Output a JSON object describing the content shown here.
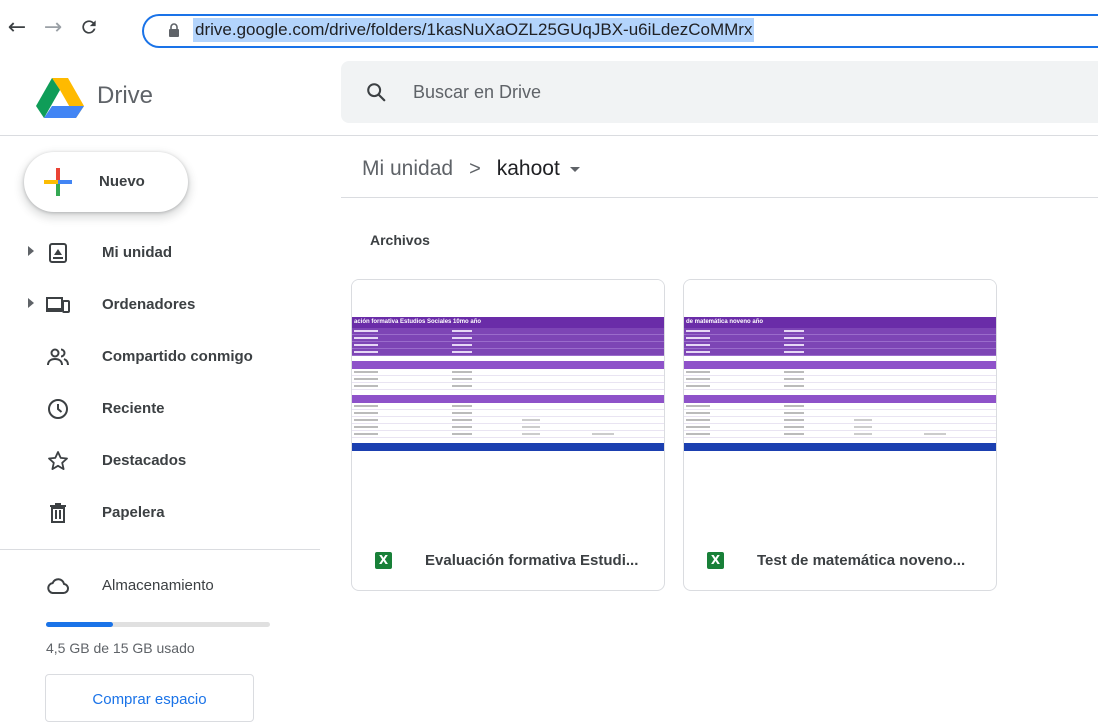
{
  "browser": {
    "url": "drive.google.com/drive/folders/1kasNuXaOZL25GUqJBX-u6iLdezCoMMrx"
  },
  "header": {
    "app_name": "Drive",
    "search_placeholder": "Buscar en Drive"
  },
  "sidebar": {
    "new_label": "Nuevo",
    "items": [
      {
        "label": "Mi unidad",
        "icon": "drive-icon"
      },
      {
        "label": "Ordenadores",
        "icon": "computers-icon"
      },
      {
        "label": "Compartido conmigo",
        "icon": "shared-icon"
      },
      {
        "label": "Reciente",
        "icon": "clock-icon"
      },
      {
        "label": "Destacados",
        "icon": "star-icon"
      },
      {
        "label": "Papelera",
        "icon": "trash-icon"
      }
    ],
    "storage": {
      "label": "Almacenamiento",
      "used_text": "4,5 GB de 15 GB usado",
      "used_fraction": 0.3,
      "buy_label": "Comprar espacio"
    }
  },
  "main": {
    "breadcrumb": {
      "root": "Mi unidad",
      "separator": ">",
      "current": "kahoot"
    },
    "section_title": "Archivos",
    "files": [
      {
        "name": "Evaluación formativa Estudi...",
        "thumb_title": "ación formativa Estudios Sociales 10mo año",
        "type_badge": "X"
      },
      {
        "name": "Test de matemática noveno...",
        "thumb_title": "de matemática noveno año",
        "type_badge": "X"
      }
    ]
  },
  "colors": {
    "accent": "#1a73e8",
    "sheet_purple": "#6a2ca8",
    "sheets_green": "#188038"
  }
}
